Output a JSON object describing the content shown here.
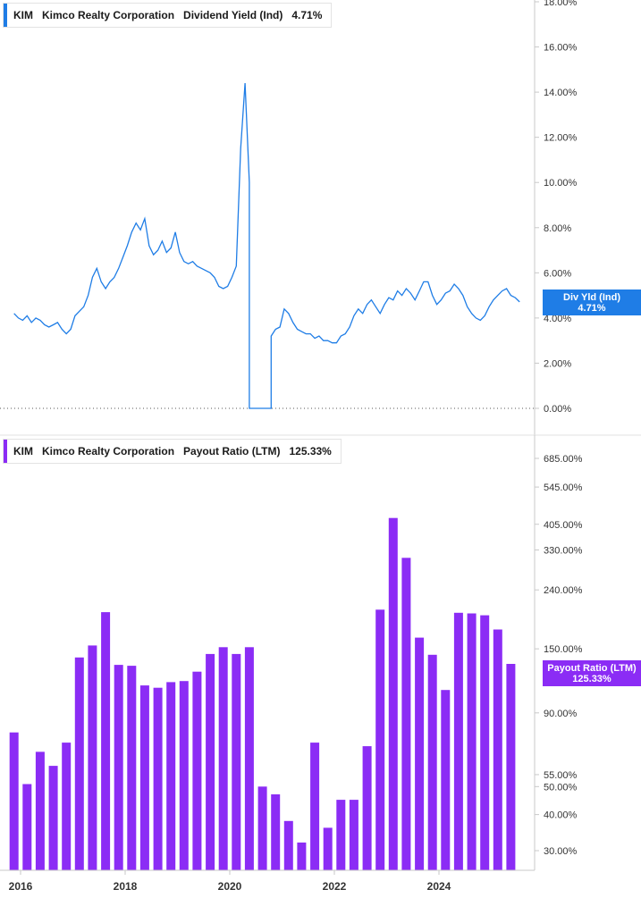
{
  "colors": {
    "yield_line": "#1f7de6",
    "payout_bar": "#8b2cf5",
    "axis": "#c8c8c8",
    "zero_line": "#555555"
  },
  "top_legend": {
    "ticker": "KIM",
    "company": "Kimco Realty Corporation",
    "metric": "Dividend Yield (Ind)",
    "value": "4.71%"
  },
  "bottom_legend": {
    "ticker": "KIM",
    "company": "Kimco Realty Corporation",
    "metric": "Payout Ratio (LTM)",
    "value": "125.33%"
  },
  "top_tag": {
    "line1": "Div Yld (Ind)",
    "line2": "4.71%"
  },
  "bottom_tag": {
    "line1": "Payout Ratio (LTM)",
    "line2": "125.33%"
  },
  "chart_data": [
    {
      "type": "line",
      "series": [
        {
          "name": "Dividend Yield (Ind)"
        }
      ],
      "ylim": [
        0,
        18
      ],
      "y_ticks": [
        {
          "value": 0,
          "label": "0.00%"
        },
        {
          "value": 2,
          "label": "2.00%"
        },
        {
          "value": 4,
          "label": "4.00%"
        },
        {
          "value": 6,
          "label": "6.00%"
        },
        {
          "value": 8,
          "label": "8.00%"
        },
        {
          "value": 10,
          "label": "10.00%"
        },
        {
          "value": 12,
          "label": "12.00%"
        },
        {
          "value": 14,
          "label": "14.00%"
        },
        {
          "value": 16,
          "label": "16.00%"
        },
        {
          "value": 18,
          "label": "18.00%"
        }
      ],
      "points": [
        [
          "2015-11",
          4.2
        ],
        [
          "2015-12",
          4.0
        ],
        [
          "2016-01",
          3.9
        ],
        [
          "2016-02",
          4.1
        ],
        [
          "2016-03",
          3.8
        ],
        [
          "2016-04",
          4.0
        ],
        [
          "2016-05",
          3.9
        ],
        [
          "2016-06",
          3.7
        ],
        [
          "2016-07",
          3.6
        ],
        [
          "2016-08",
          3.7
        ],
        [
          "2016-09",
          3.8
        ],
        [
          "2016-10",
          3.5
        ],
        [
          "2016-11",
          3.3
        ],
        [
          "2016-12",
          3.5
        ],
        [
          "2017-01",
          4.1
        ],
        [
          "2017-02",
          4.3
        ],
        [
          "2017-03",
          4.5
        ],
        [
          "2017-04",
          5.0
        ],
        [
          "2017-05",
          5.8
        ],
        [
          "2017-06",
          6.2
        ],
        [
          "2017-07",
          5.6
        ],
        [
          "2017-08",
          5.3
        ],
        [
          "2017-09",
          5.6
        ],
        [
          "2017-10",
          5.8
        ],
        [
          "2017-11",
          6.2
        ],
        [
          "2017-12",
          6.7
        ],
        [
          "2018-01",
          7.2
        ],
        [
          "2018-02",
          7.8
        ],
        [
          "2018-03",
          8.2
        ],
        [
          "2018-04",
          7.9
        ],
        [
          "2018-05",
          8.4
        ],
        [
          "2018-06",
          7.2
        ],
        [
          "2018-07",
          6.8
        ],
        [
          "2018-08",
          7.0
        ],
        [
          "2018-09",
          7.4
        ],
        [
          "2018-10",
          6.9
        ],
        [
          "2018-11",
          7.1
        ],
        [
          "2018-12",
          7.8
        ],
        [
          "2019-01",
          6.9
        ],
        [
          "2019-02",
          6.5
        ],
        [
          "2019-03",
          6.4
        ],
        [
          "2019-04",
          6.5
        ],
        [
          "2019-05",
          6.3
        ],
        [
          "2019-06",
          6.2
        ],
        [
          "2019-07",
          6.1
        ],
        [
          "2019-08",
          6.0
        ],
        [
          "2019-09",
          5.8
        ],
        [
          "2019-10",
          5.4
        ],
        [
          "2019-11",
          5.3
        ],
        [
          "2019-12",
          5.4
        ],
        [
          "2020-01",
          5.8
        ],
        [
          "2020-02",
          6.3
        ],
        [
          "2020-03",
          11.5
        ],
        [
          "2020-04",
          14.4
        ],
        [
          "2020-05",
          10.0
        ],
        [
          "2020-05",
          0.0
        ],
        [
          "2020-06",
          0.0
        ],
        [
          "2020-07",
          0.0
        ],
        [
          "2020-08",
          0.0
        ],
        [
          "2020-09",
          0.0
        ],
        [
          "2020-10",
          0.0
        ],
        [
          "2020-10",
          3.2
        ],
        [
          "2020-11",
          3.5
        ],
        [
          "2020-12",
          3.6
        ],
        [
          "2021-01",
          4.4
        ],
        [
          "2021-02",
          4.2
        ],
        [
          "2021-03",
          3.8
        ],
        [
          "2021-04",
          3.5
        ],
        [
          "2021-05",
          3.4
        ],
        [
          "2021-06",
          3.3
        ],
        [
          "2021-07",
          3.3
        ],
        [
          "2021-08",
          3.1
        ],
        [
          "2021-09",
          3.2
        ],
        [
          "2021-10",
          3.0
        ],
        [
          "2021-11",
          3.0
        ],
        [
          "2021-12",
          2.9
        ],
        [
          "2022-01",
          2.9
        ],
        [
          "2022-02",
          3.2
        ],
        [
          "2022-03",
          3.3
        ],
        [
          "2022-04",
          3.6
        ],
        [
          "2022-05",
          4.1
        ],
        [
          "2022-06",
          4.4
        ],
        [
          "2022-07",
          4.2
        ],
        [
          "2022-08",
          4.6
        ],
        [
          "2022-09",
          4.8
        ],
        [
          "2022-10",
          4.5
        ],
        [
          "2022-11",
          4.2
        ],
        [
          "2022-12",
          4.6
        ],
        [
          "2023-01",
          4.9
        ],
        [
          "2023-02",
          4.8
        ],
        [
          "2023-03",
          5.2
        ],
        [
          "2023-04",
          5.0
        ],
        [
          "2023-05",
          5.3
        ],
        [
          "2023-06",
          5.1
        ],
        [
          "2023-07",
          4.8
        ],
        [
          "2023-08",
          5.2
        ],
        [
          "2023-09",
          5.6
        ],
        [
          "2023-10",
          5.6
        ],
        [
          "2023-11",
          5.0
        ],
        [
          "2023-12",
          4.6
        ],
        [
          "2024-01",
          4.8
        ],
        [
          "2024-02",
          5.1
        ],
        [
          "2024-03",
          5.2
        ],
        [
          "2024-04",
          5.5
        ],
        [
          "2024-05",
          5.3
        ],
        [
          "2024-06",
          5.0
        ],
        [
          "2024-07",
          4.5
        ],
        [
          "2024-08",
          4.2
        ],
        [
          "2024-09",
          4.0
        ],
        [
          "2024-10",
          3.9
        ],
        [
          "2024-11",
          4.1
        ],
        [
          "2024-12",
          4.5
        ],
        [
          "2025-01",
          4.8
        ],
        [
          "2025-02",
          5.0
        ],
        [
          "2025-03",
          5.2
        ],
        [
          "2025-04",
          5.3
        ],
        [
          "2025-05",
          5.0
        ],
        [
          "2025-06",
          4.9
        ],
        [
          "2025-07",
          4.71
        ]
      ]
    },
    {
      "type": "bar",
      "series": [
        {
          "name": "Payout Ratio (LTM)"
        }
      ],
      "y_scale": "log",
      "ylim": [
        26,
        800
      ],
      "y_ticks": [
        {
          "value": 30,
          "label": "30.00%"
        },
        {
          "value": 40,
          "label": "40.00%"
        },
        {
          "value": 50,
          "label": "50.00%"
        },
        {
          "value": 55,
          "label": "55.00%"
        },
        {
          "value": 90,
          "label": "90.00%"
        },
        {
          "value": 150,
          "label": "150.00%"
        },
        {
          "value": 240,
          "label": "240.00%"
        },
        {
          "value": 330,
          "label": "330.00%"
        },
        {
          "value": 405,
          "label": "405.00%"
        },
        {
          "value": 545,
          "label": "545.00%"
        },
        {
          "value": 685,
          "label": "685.00%"
        }
      ],
      "bars": [
        [
          "2015-Q4",
          77
        ],
        [
          "2016-Q1",
          51
        ],
        [
          "2016-Q2",
          66
        ],
        [
          "2016-Q3",
          59
        ],
        [
          "2016-Q4",
          71
        ],
        [
          "2017-Q1",
          140
        ],
        [
          "2017-Q2",
          154
        ],
        [
          "2017-Q3",
          201
        ],
        [
          "2017-Q4",
          132
        ],
        [
          "2018-Q1",
          131
        ],
        [
          "2018-Q2",
          112
        ],
        [
          "2018-Q3",
          110
        ],
        [
          "2018-Q4",
          115
        ],
        [
          "2019-Q1",
          116
        ],
        [
          "2019-Q2",
          125
        ],
        [
          "2019-Q3",
          144
        ],
        [
          "2019-Q4",
          152
        ],
        [
          "2020-Q1",
          144
        ],
        [
          "2020-Q2",
          152
        ],
        [
          "2020-Q3",
          50
        ],
        [
          "2020-Q4",
          47
        ],
        [
          "2021-Q1",
          38
        ],
        [
          "2021-Q2",
          32
        ],
        [
          "2021-Q3",
          71
        ],
        [
          "2021-Q4",
          36
        ],
        [
          "2022-Q1",
          45
        ],
        [
          "2022-Q2",
          45
        ],
        [
          "2022-Q3",
          69
        ],
        [
          "2022-Q4",
          205
        ],
        [
          "2023-Q1",
          426
        ],
        [
          "2023-Q2",
          310
        ],
        [
          "2023-Q3",
          164
        ],
        [
          "2023-Q4",
          143
        ],
        [
          "2024-Q1",
          108
        ],
        [
          "2024-Q2",
          200
        ],
        [
          "2024-Q3",
          199
        ],
        [
          "2024-Q4",
          196
        ],
        [
          "2025-Q1",
          175
        ],
        [
          "2025-Q2",
          133
        ]
      ]
    }
  ],
  "x_axis": {
    "ticks": [
      "2016",
      "2018",
      "2020",
      "2022",
      "2024"
    ]
  }
}
